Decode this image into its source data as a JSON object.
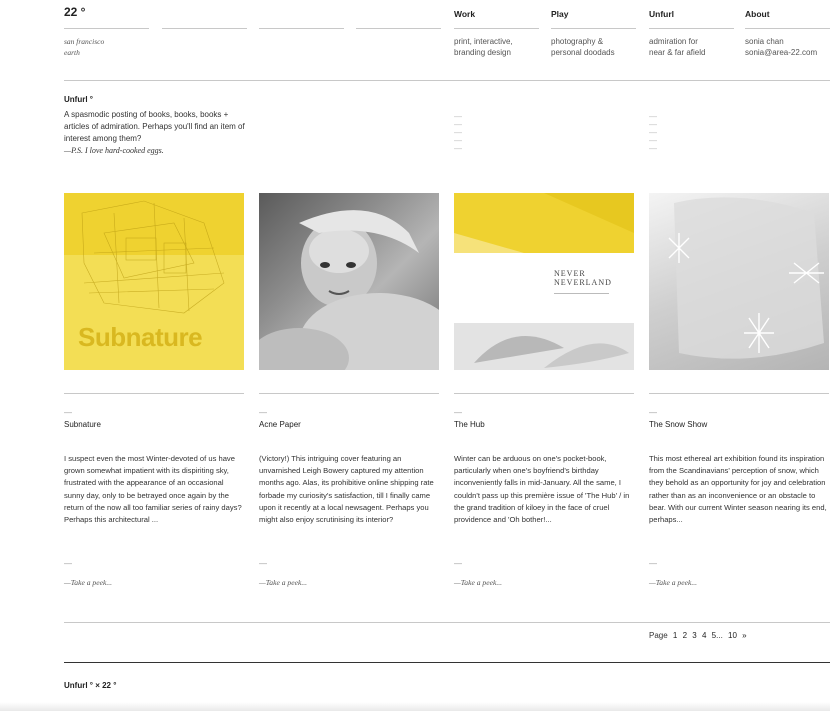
{
  "header": {
    "logo": "22 °",
    "location_line1": "san francisco",
    "location_line2": "earth",
    "nav": [
      {
        "title": "Work",
        "desc1": "print, interactive,",
        "desc2": "branding design"
      },
      {
        "title": "Play",
        "desc1": "photography &",
        "desc2": "personal doodads"
      },
      {
        "title": "Unfurl",
        "desc1": "admiration for",
        "desc2": "near & far afield"
      },
      {
        "title": "About",
        "desc1": "sonia chan",
        "desc2": "sonia@area-22.com"
      }
    ]
  },
  "intro": {
    "title": "Unfurl °",
    "text": "A spasmodic posting of books, books, books + articles of admiration. Perhaps you'll find an item of interest among them?",
    "ps": "—P.S. I love hard-cooked eggs."
  },
  "dash": "—",
  "cards": [
    {
      "thumb_text": "Subnature",
      "title": "Subnature",
      "text": "I suspect even the most Winter-devoted of us have grown somewhat impatient with its dispiriting sky, frustrated with the appearance of an occasional sunny day, only to be betrayed once again by the return of the now all too familiar series of rainy days? Perhaps this architectural ...",
      "link": "—Take a peek..."
    },
    {
      "thumb_text": "",
      "title": "Acne Paper",
      "text": "(Victory!) This intriguing cover featuring an unvarnished Leigh Bowery captured my attention months ago. Alas, its prohibitive online shipping rate forbade my curiosity's satisfaction, till I finally came upon it recently at a local newsagent. Perhaps you might also enjoy scrutinising its interior?",
      "link": "—Take a peek..."
    },
    {
      "thumb_text": "NEVER NEVERLAND",
      "title": "The Hub",
      "text": "Winter can be arduous on one's pocket-book, particularly when one's boyfriend's birthday inconveniently falls in mid-January. All the same, I couldn't pass up this première issue of 'The Hub' / in the grand tradition of kiloey in the face of cruel providence and 'Oh bother!...",
      "link": "—Take a peek..."
    },
    {
      "thumb_text": "",
      "title": "The Snow Show",
      "text": "This most ethereal art exhibition found its inspiration from the Scandinavians' perception of snow, which they behold as an opportunity for joy and celebration rather than as an inconvenience or an obstacle to bear. With our current Winter season nearing its end, perhaps...",
      "link": "—Take a peek..."
    }
  ],
  "pagination": {
    "label": "Page",
    "pages": [
      "1",
      "2",
      "3",
      "4",
      "5"
    ],
    "ellipsis": "...",
    "last": "10",
    "next": "»"
  },
  "footer": {
    "title": "Unfurl ° × 22 °"
  },
  "colors": {
    "accent_yellow": "#f0d43a",
    "rule": "#c8c8c8"
  }
}
